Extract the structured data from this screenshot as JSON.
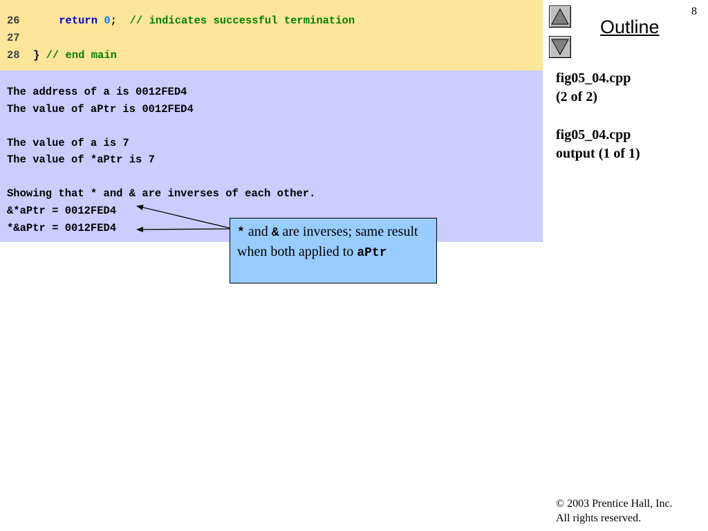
{
  "code_lines": [
    {
      "num": "26",
      "indent": "    ",
      "kw": "return",
      "num_lit": "0",
      "semi": ";",
      "comment": "// indicates successful termination"
    },
    {
      "num": "27"
    },
    {
      "num": "28",
      "brace": "}",
      "comment": "// end main"
    }
  ],
  "output_lines": [
    "The address of a is 0012FED4",
    "The value of aPtr is 0012FED4",
    "",
    "The value of a is 7",
    "The value of *aPtr is 7",
    "",
    "Showing that * and & are inverses of each other.",
    "&*aPtr = 0012FED4",
    "*&aPtr = 0012FED4"
  ],
  "nav": {
    "title": "Outline",
    "up_icon": "triangle-up-icon",
    "down_icon": "triangle-down-icon"
  },
  "page_number": "8",
  "side": {
    "file1": "fig05_04.cpp",
    "file1_part": "(2 of 2)",
    "file2": "fig05_04.cpp",
    "file2_part": "output (1 of 1)"
  },
  "callout": {
    "star": "*",
    "and_word": " and ",
    "amp": "&",
    "text1": " are inverses; same result when both applied to ",
    "var": "aPtr"
  },
  "footer": {
    "copyright": "© 2003 Prentice Hall, Inc.",
    "rights": "All rights reserved."
  }
}
